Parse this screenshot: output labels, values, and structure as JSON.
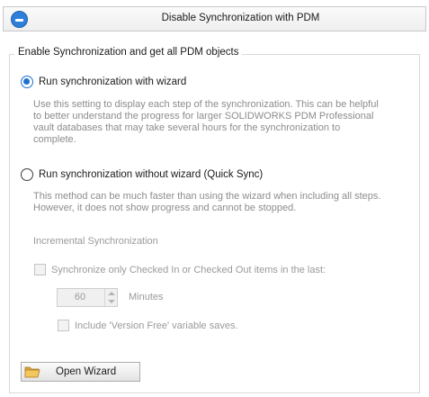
{
  "header": {
    "title": "Disable Synchronization with PDM",
    "toggle_icon": "collapse-minus-icon"
  },
  "group": {
    "legend": "Enable Synchronization and get all PDM objects"
  },
  "options": [
    {
      "label": "Run synchronization with wizard",
      "selected": true,
      "description_lines": [
        "Use this setting to display each step of the synchronization.  This can be helpful",
        "to better understand the progress for larger SOLIDWORKS PDM Professional",
        "vault databases that may take several hours for the synchronization to",
        "complete."
      ]
    },
    {
      "label": "Run synchronization without wizard (Quick Sync)",
      "selected": false,
      "description_lines": [
        "This method can be much faster than using the wizard when including all steps.",
        "However, it does not show progress and cannot be stopped."
      ]
    }
  ],
  "incremental": {
    "section_label": "Incremental Synchronization",
    "sync_checkbox_label": "Synchronize only Checked In or Checked Out items in the last:",
    "sync_checked": false,
    "minutes_value": "60",
    "minutes_unit": "Minutes",
    "version_free_label": "Include 'Version Free' variable saves.",
    "version_free_checked": false
  },
  "wizard_button": {
    "label": "Open Wizard",
    "icon": "open-folder-icon"
  },
  "colors": {
    "accent": "#1f6fd0",
    "disabled_text": "#9a9a9a"
  }
}
